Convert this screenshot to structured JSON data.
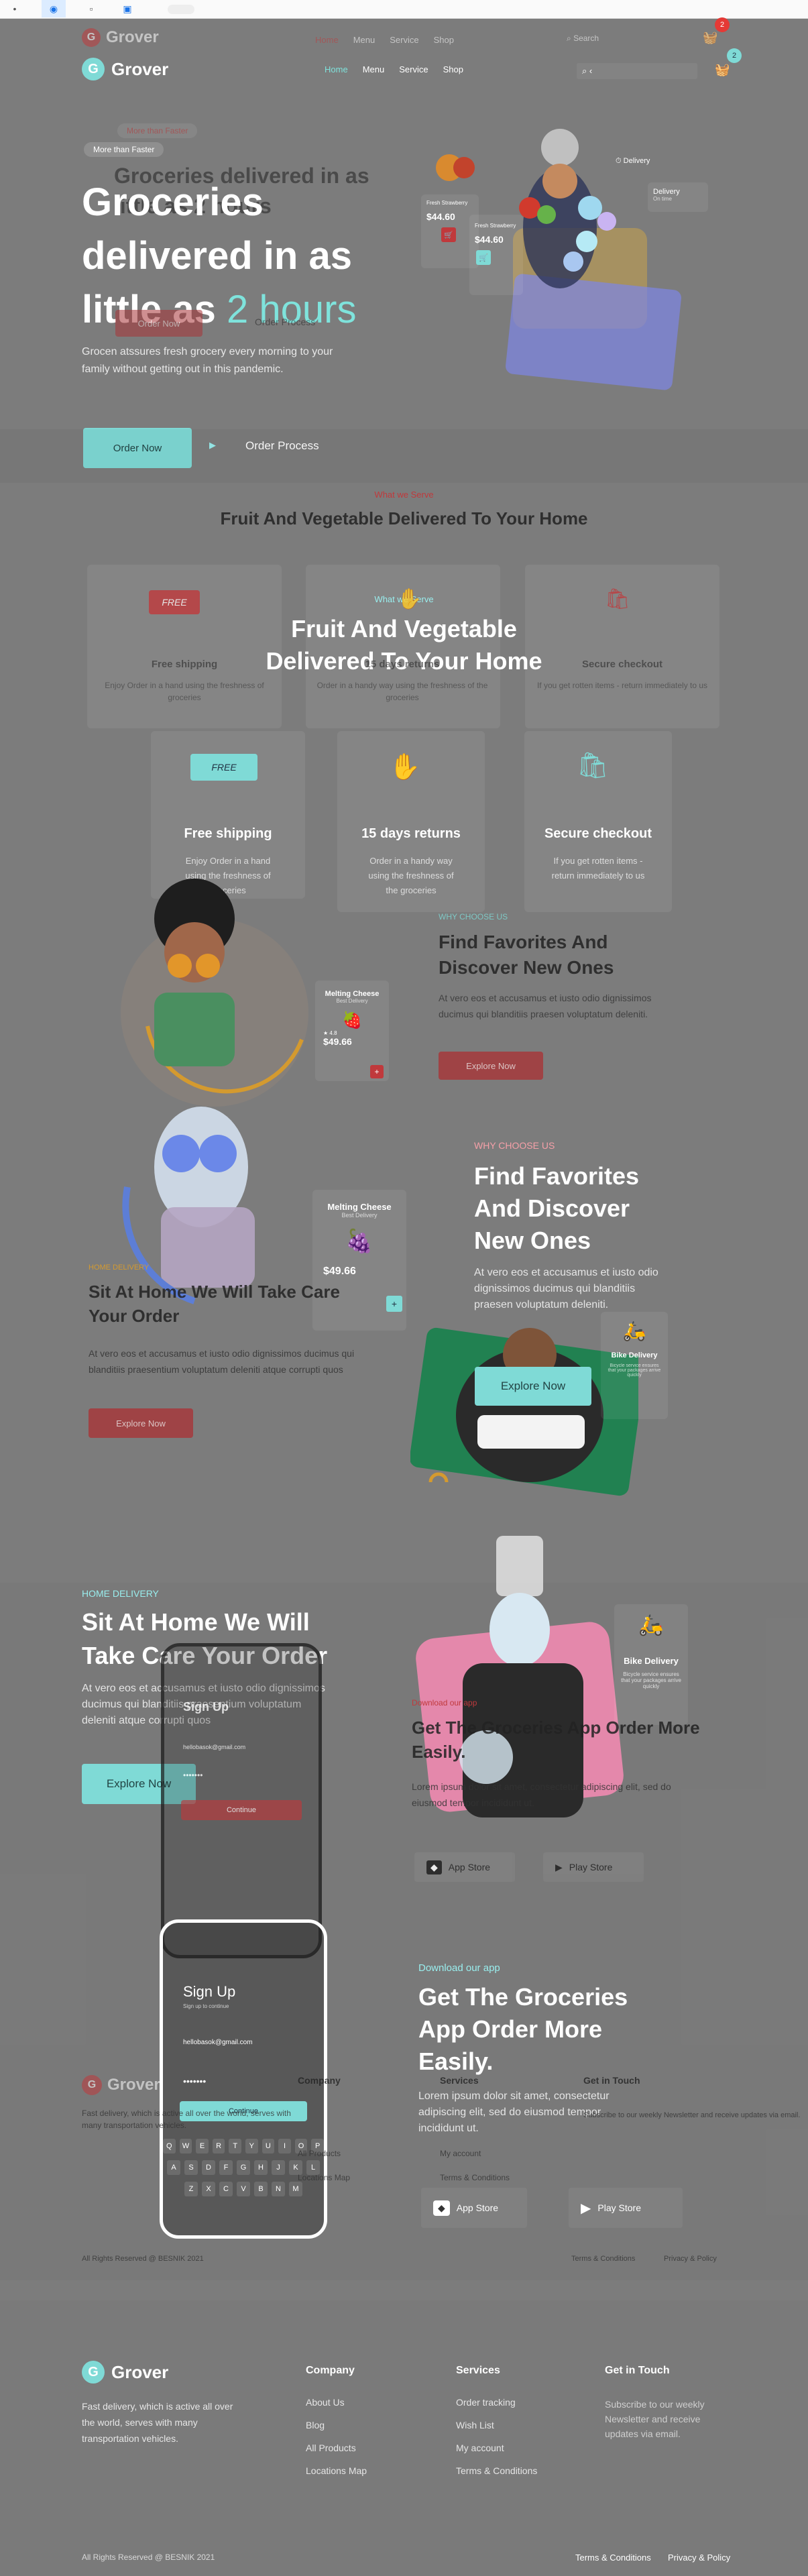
{
  "browser": {
    "tab_icons": [
      "dot-icon",
      "eye-icon",
      "lock-icon",
      "shield-icon"
    ]
  },
  "brand": {
    "name": "Grover",
    "letter": "G"
  },
  "nav": {
    "home": "Home",
    "menu": "Menu",
    "service": "Service",
    "shop": "Shop",
    "search_placeholder": "Search",
    "cart_count": "2"
  },
  "hero": {
    "badge": "More than Faster",
    "title_line1": "Groceries",
    "title_line2": "delivered in as",
    "title_line3a": "little as ",
    "title_line3b": "2 hours",
    "ghost_title": "Groceries delivered in as little as 2 hours",
    "description": "Grocen atssures fresh grocery every morning to your family without getting out in this pandemic.",
    "cta": "Order Now",
    "secondary_cta": "Order Process",
    "product_name": "Fresh Strawberry",
    "product_price": "$44.60",
    "delivery_label": "Delivery",
    "delivery_sub": "On time"
  },
  "services": {
    "eyebrow": "What we Serve",
    "title_ghost": "Fruit And Vegetable Delivered To Your Home",
    "title_line1": "Fruit And Vegetable",
    "title_line2": "Delivered To Your Home",
    "items": [
      {
        "icon": "free-shipping-icon",
        "badge": "FREE",
        "title": "Free shipping",
        "text": "Enjoy Order in a hand using the freshness of groceries"
      },
      {
        "icon": "returns-icon",
        "title": "15 days returns",
        "text": "Order in a handy way using the freshness of the groceries"
      },
      {
        "icon": "secure-checkout-icon",
        "title": "Secure checkout",
        "text": "If you get rotten items - return immediately to us"
      }
    ],
    "ghost_items": [
      {
        "title": "Free shipping",
        "text": "Enjoy Order in a hand using the freshness of groceries"
      },
      {
        "title": "15 days returns",
        "text": "Order in a handy way using the freshness of the groceries"
      },
      {
        "title": "Secure checkout",
        "text": "If you get rotten items - return immediately to us"
      }
    ]
  },
  "favorites": {
    "eyebrow": "WHY CHOOSE US",
    "title_ghost": "Find Favorites And Discover New Ones",
    "title_line1": "Find Favorites",
    "title_line2": "And Discover",
    "title_line3": "New Ones",
    "text": "At vero eos et accusamus et iusto odio dignissimos ducimus qui blanditiis praesen voluptatum deleniti.",
    "cta": "Explore Now",
    "card_title": "Melting Cheese",
    "card_sub": "Best Delivery",
    "card_price": "$49.66",
    "card_rating": "4.8"
  },
  "care": {
    "eyebrow": "HOME DELIVERY",
    "title_ghost": "Sit At Home We Will Take Care Your Order",
    "title_line1": "Sit At Home We Will",
    "title_line2": "Take Care Your Order",
    "text": "At vero eos et accusamus et iusto odio dignissimos ducimus qui blanditiis praesentium voluptatum deleniti atque corrupti quos",
    "cta": "Explore Now",
    "bike_title": "Bike Delivery",
    "bike_text": "Bicycle service ensures that your packages arrive quickly"
  },
  "app": {
    "eyebrow": "Download our app",
    "title_ghost": "Get The Groceries App Order More Easily.",
    "title_line1": "Get The Groceries",
    "title_line2": "App Order More",
    "title_line3": "Easily.",
    "text": "Lorem ipsum dolor sit amet, consectetur adipiscing elit, sed do eiusmod tempor incididunt ut.",
    "app_store": "App Store",
    "play_store": "Play Store",
    "signup_title": "Sign Up",
    "signup_sub": "Sign up to continue",
    "email_value": "hellobasok@gmail.com",
    "password_value": "•••••••",
    "continue_label": "Continue",
    "keys_row1": [
      "Q",
      "W",
      "E",
      "R",
      "T",
      "Y",
      "U",
      "I",
      "O",
      "P"
    ],
    "keys_row2": [
      "A",
      "S",
      "D",
      "F",
      "G",
      "H",
      "J",
      "K",
      "L"
    ],
    "keys_row3": [
      "Z",
      "X",
      "C",
      "V",
      "B",
      "N",
      "M"
    ]
  },
  "footer": {
    "description": "Fast delivery, which is active all over the world, serves with many transportation vehicles.",
    "company_title": "Company",
    "company_links": [
      "About Us",
      "Blog",
      "All Products",
      "Locations Map"
    ],
    "services_title": "Services",
    "services_links": [
      "Order tracking",
      "Wish List",
      "My account",
      "Terms & Conditions"
    ],
    "contact_title": "Get in Touch",
    "contact_text": "Subscribe to our weekly Newsletter and receive updates via email.",
    "copyright": "All Rights Reserved @ BESNIK 2021",
    "terms": "Terms & Conditions",
    "privacy": "Privacy & Policy"
  },
  "colors": {
    "teal": "#7fdad6",
    "red": "#c0393c",
    "background": "#7c7c7c"
  }
}
